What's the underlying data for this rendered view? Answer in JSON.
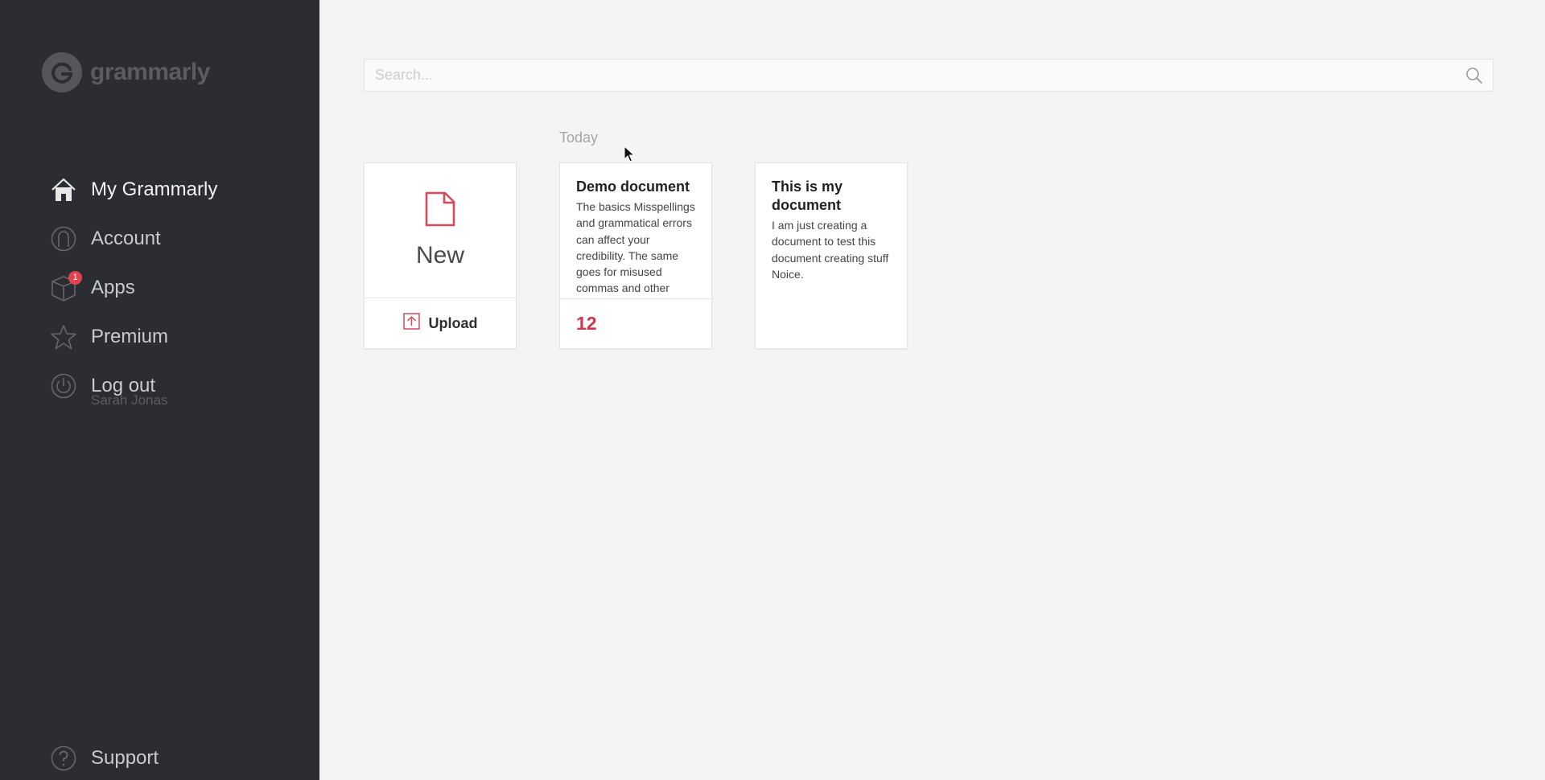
{
  "app": {
    "name": "grammarly",
    "accent_color": "#d0354a",
    "sidebar_color": "#2c2d33"
  },
  "sidebar": {
    "items": [
      {
        "label": "My Grammarly",
        "icon": "home-icon",
        "active": true
      },
      {
        "label": "Account",
        "icon": "user-icon"
      },
      {
        "label": "Apps",
        "icon": "box-icon",
        "badge": "1"
      },
      {
        "label": "Premium",
        "icon": "star-icon"
      },
      {
        "label": "Log out",
        "icon": "power-icon"
      }
    ],
    "username": "Sarah Jonas",
    "support": {
      "label": "Support",
      "icon": "help-icon"
    }
  },
  "search": {
    "placeholder": "Search...",
    "value": ""
  },
  "documents": {
    "section_label": "Today",
    "new_card": {
      "new_label": "New",
      "upload_label": "Upload"
    },
    "items": [
      {
        "title": "Demo document",
        "preview": "The basics Misspellings and grammatical errors can affect your credibility. The same goes for misused commas and other",
        "issues": "12"
      },
      {
        "title": "This is my document",
        "preview": "I am just creating a document to test this document creating stuff Noice."
      }
    ]
  }
}
